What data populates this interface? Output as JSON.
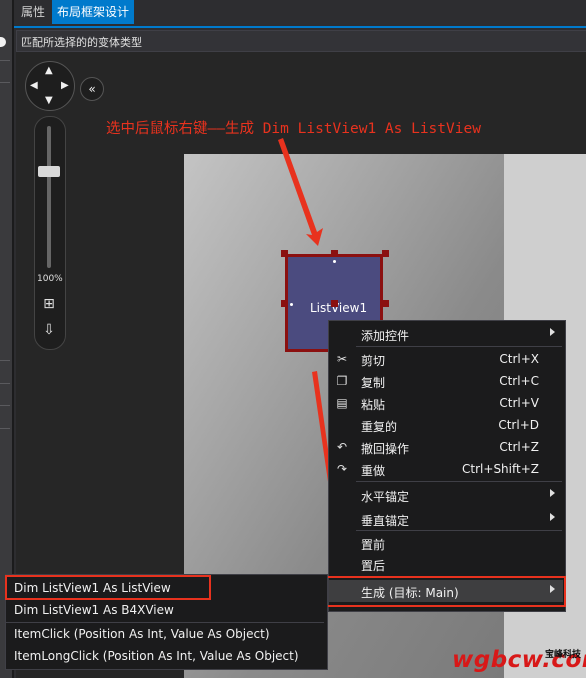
{
  "tabs": {
    "properties": "属性",
    "layout_designer": "布局框架设计"
  },
  "type_filter": {
    "label": "匹配所选择的的变体类型"
  },
  "zoom": {
    "level": "100%"
  },
  "annotation": "选中后鼠标右键——生成 Dim ListView1 As ListView",
  "control": {
    "name": "ListView1"
  },
  "context_menu": {
    "add_control": "添加控件",
    "cut": "剪切",
    "cut_shortcut": "Ctrl+X",
    "copy": "复制",
    "copy_shortcut": "Ctrl+C",
    "paste": "粘贴",
    "paste_shortcut": "Ctrl+V",
    "duplicate": "重复的",
    "duplicate_shortcut": "Ctrl+D",
    "undo": "撤回操作",
    "undo_shortcut": "Ctrl+Z",
    "redo": "重做",
    "redo_shortcut": "Ctrl+Shift+Z",
    "h_anchor": "水平锚定",
    "v_anchor": "垂直锚定",
    "bring_front": "置前",
    "send_back": "置后",
    "generate": "生成 (目标: Main)"
  },
  "generate_submenu": [
    "Dim ListView1 As ListView",
    "Dim ListView1 As B4XView",
    "ItemClick (Position As Int, Value As Object)",
    "ItemLongClick (Position As Int, Value As Object)"
  ],
  "watermark": {
    "main": "wgbcw.com",
    "sub": "宝峰科技"
  },
  "colors": {
    "accent": "#007acc",
    "annotation_red": "#e8321e",
    "control_fill": "#4b4b7f",
    "control_border": "#8b1010"
  }
}
